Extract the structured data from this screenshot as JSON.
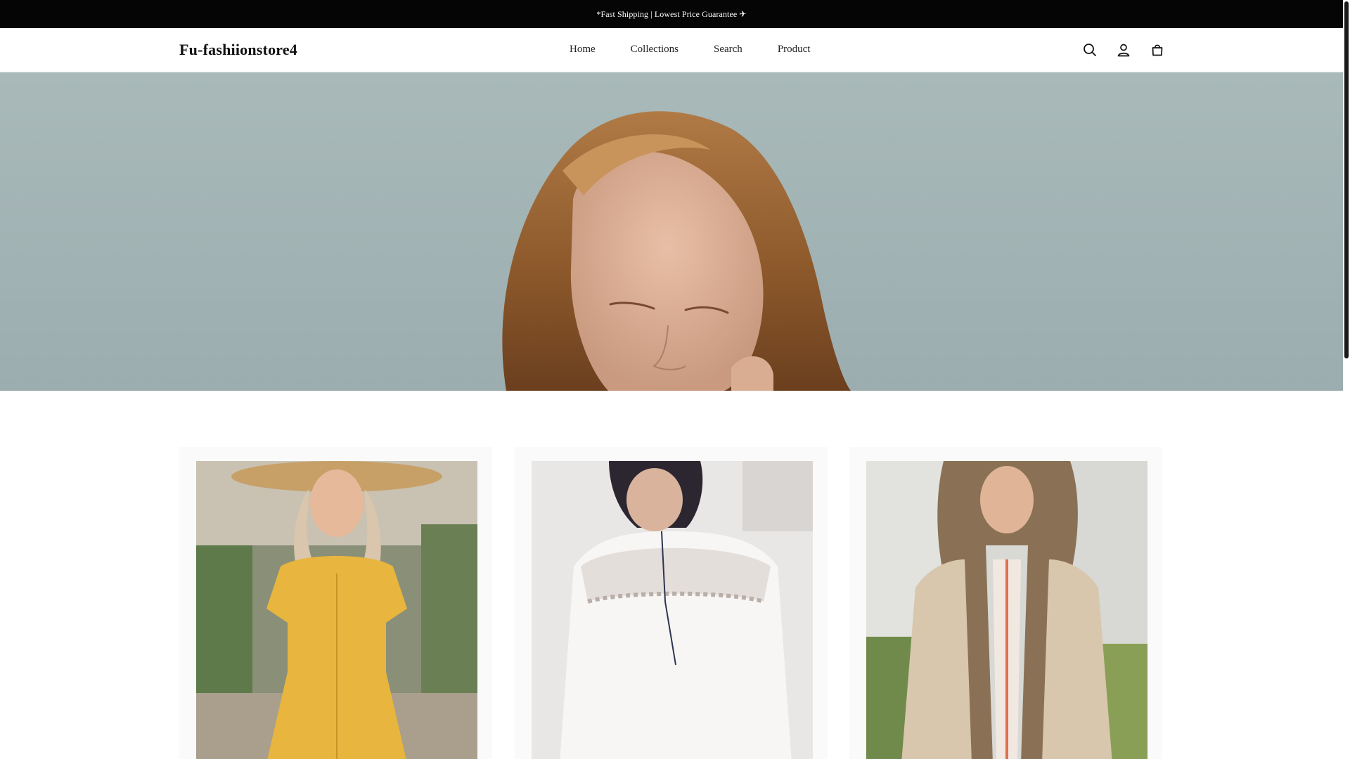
{
  "announcement": {
    "text": "*Fast Shipping | Lowest Price Guarantee ✈"
  },
  "header": {
    "logo": "Fu-fashiionstore4",
    "nav": [
      {
        "label": "Home"
      },
      {
        "label": "Collections"
      },
      {
        "label": "Search"
      },
      {
        "label": "Product"
      }
    ],
    "icons": [
      "search-icon",
      "account-icon",
      "cart-icon"
    ]
  },
  "hero": {
    "image": "woman-with-freckles-looking-down"
  },
  "products": [
    {
      "image": "woman-in-yellow-button-dress-and-straw-hat"
    },
    {
      "image": "woman-in-white-lace-blouse"
    },
    {
      "image": "woman-in-beige-parka-with-fur-hood"
    }
  ],
  "colors": {
    "announcement_bg": "#050505",
    "announcement_text": "#ffffff",
    "hero_bg": "#a4b5b6",
    "text": "#111111"
  }
}
